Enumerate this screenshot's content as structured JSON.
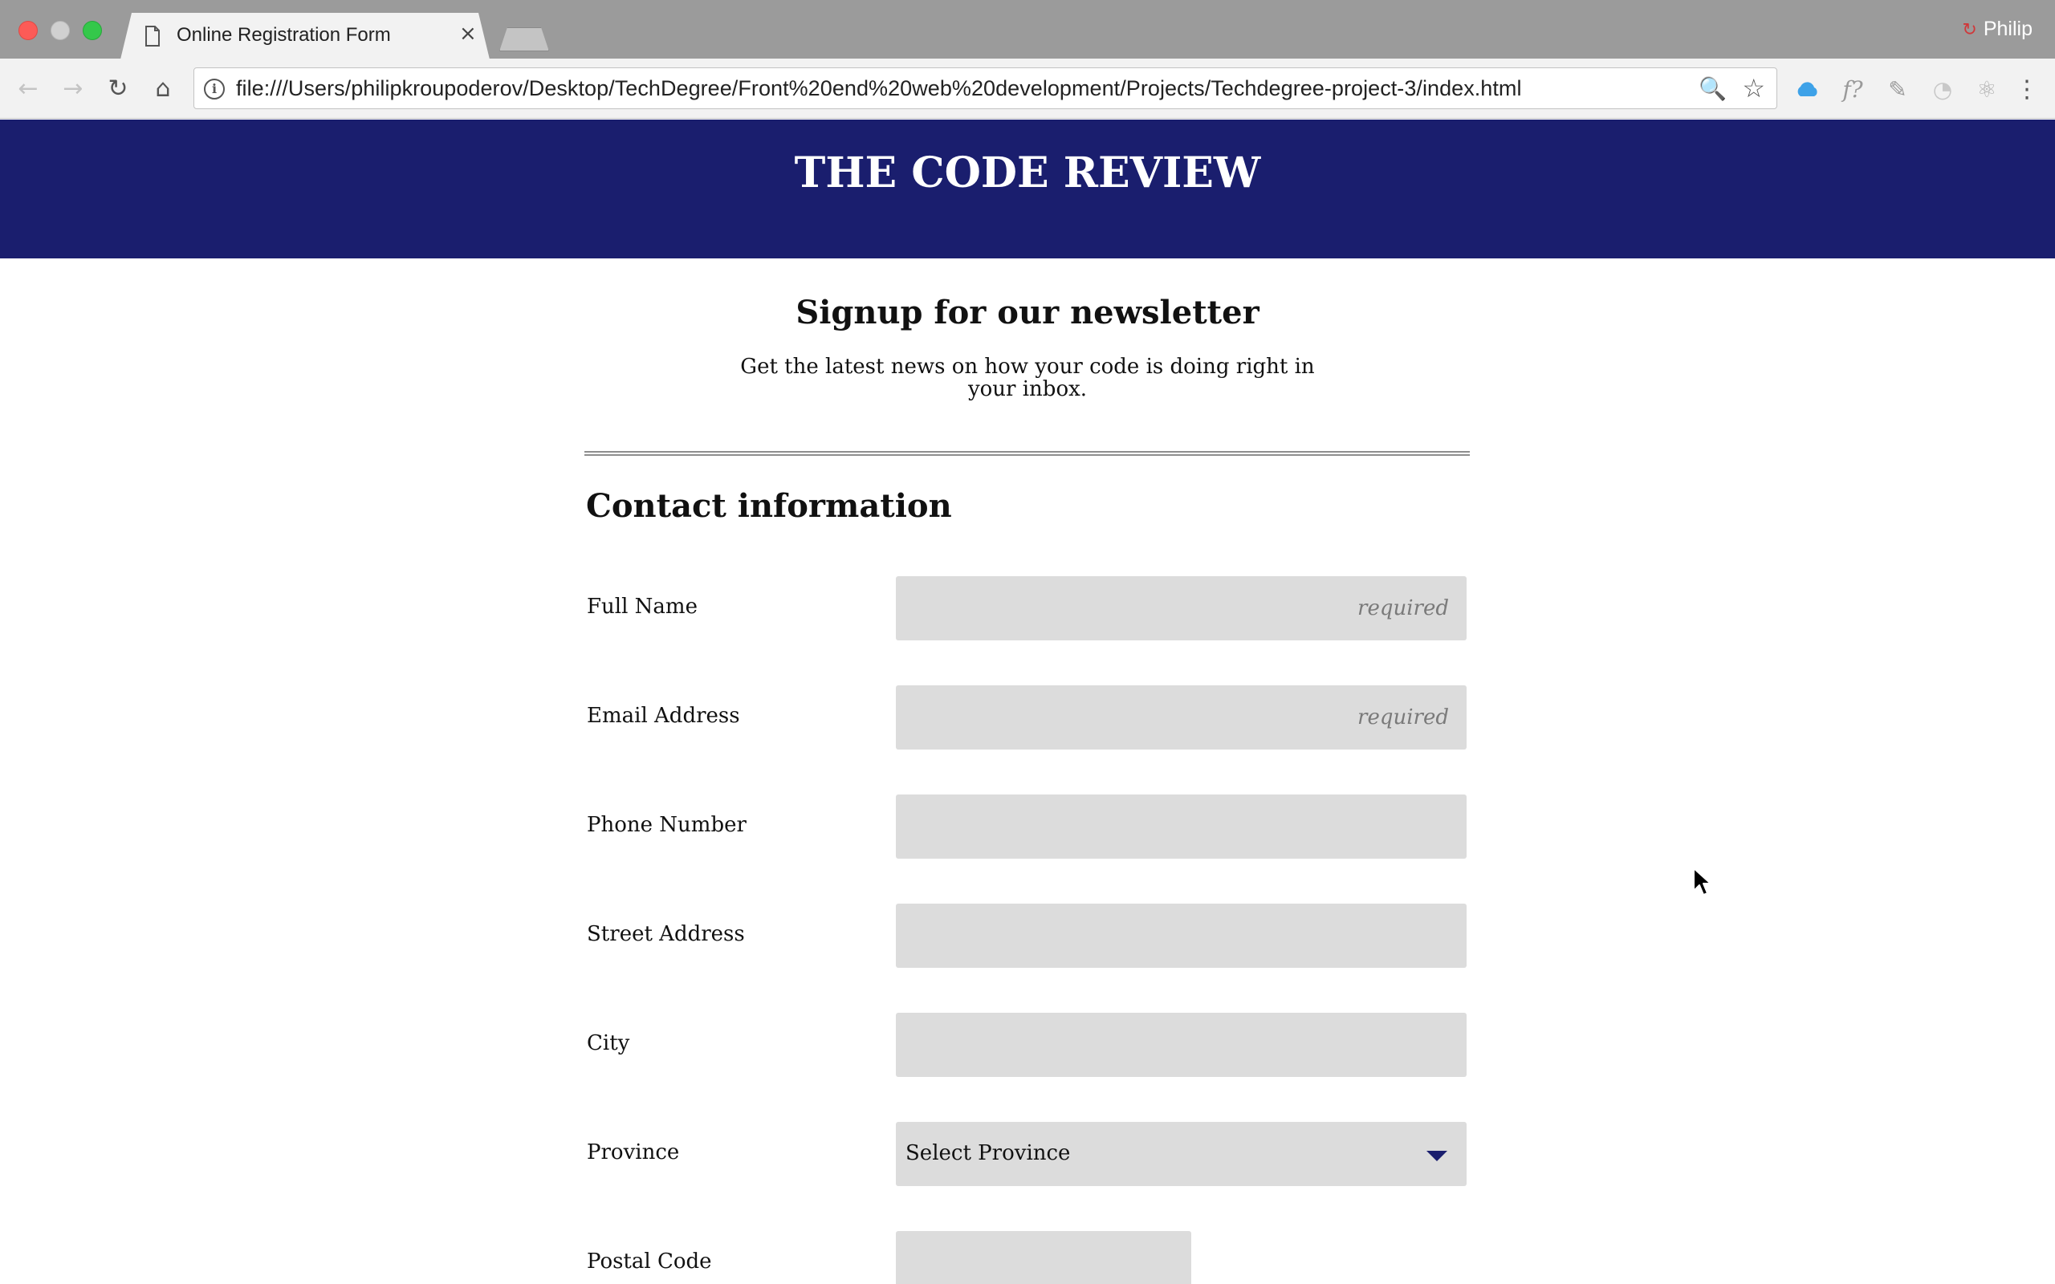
{
  "browser": {
    "tab_title": "Online Registration Form",
    "tab_close_glyph": "×",
    "profile_name": "Philip",
    "url": "file:///Users/philipkroupoderov/Desktop/TechDegree/Front%20end%20web%20development/Projects/Techdegree-project-3/index.html",
    "icons": {
      "back": "←",
      "forward": "→",
      "reload": "↻",
      "home": "⌂",
      "info": "i",
      "zoom": "🔍",
      "star": "☆",
      "font": "f?",
      "pen": "✎",
      "swirl": "◔",
      "atom": "⚛",
      "menu": "⋮",
      "profile": "↻"
    }
  },
  "header": {
    "site_title": "THE CODE REVIEW",
    "color": "#1a1e6e"
  },
  "newsletter": {
    "title": "Signup for our newsletter",
    "description": "Get the latest news on how your code is doing right in your inbox."
  },
  "contact": {
    "section_title": "Contact information",
    "fields": [
      {
        "label": "Full Name",
        "placeholder": "required",
        "value": ""
      },
      {
        "label": "Email Address",
        "placeholder": "required",
        "value": ""
      },
      {
        "label": "Phone Number",
        "placeholder": "",
        "value": ""
      },
      {
        "label": "Street Address",
        "placeholder": "",
        "value": ""
      },
      {
        "label": "City",
        "placeholder": "",
        "value": ""
      },
      {
        "label": "Province",
        "selected": "Select Province"
      },
      {
        "label": "Postal Code",
        "placeholder": "",
        "value": ""
      }
    ]
  }
}
